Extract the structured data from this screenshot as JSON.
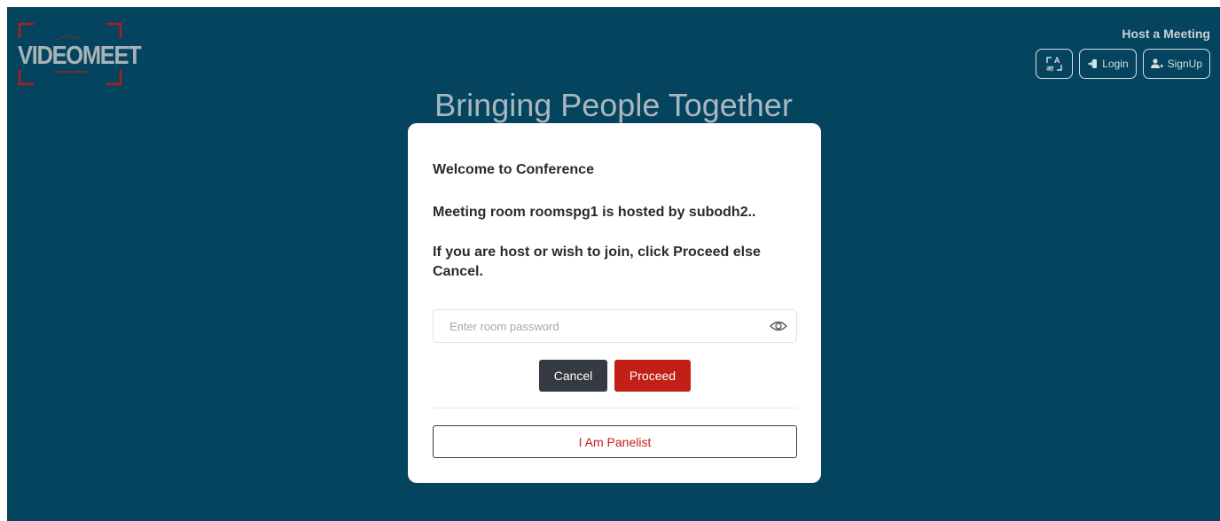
{
  "brand": {
    "logo_text": "VIDEOMEET",
    "accent": "#c21f16",
    "background": "#04445e"
  },
  "header": {
    "host_link": "Host a Meeting",
    "language_icon": "language-toggle-icon",
    "login_label": "Login",
    "signup_label": "SignUp"
  },
  "headline": "Bringing People Together",
  "modal": {
    "welcome": "Welcome to Conference",
    "room_info": "Meeting room roomspg1 is hosted by subodh2..",
    "instruction": "If you are host or wish to join, click Proceed else Cancel.",
    "password_placeholder": "Enter room password",
    "password_value": "",
    "cancel_label": "Cancel",
    "proceed_label": "Proceed",
    "panelist_label": "I Am Panelist"
  }
}
